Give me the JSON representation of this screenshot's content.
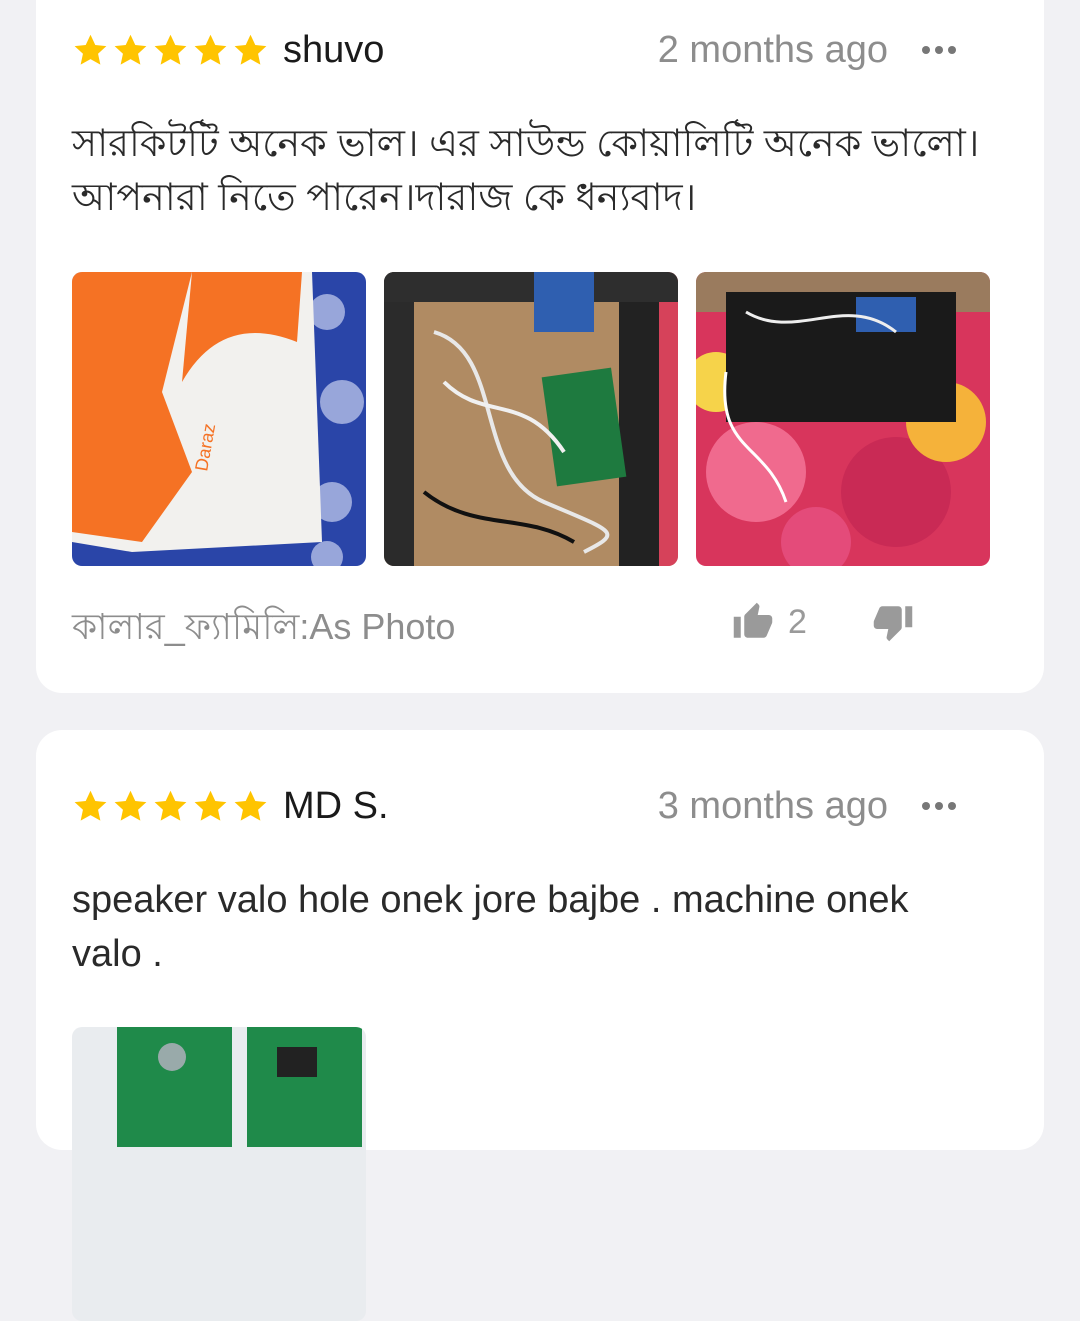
{
  "reviews": [
    {
      "rating": 5,
      "author": "shuvo",
      "time": "2 months ago",
      "text": "সারকিটটি অনেক ভাল। এর সাউন্ড কোয়ালিটি অনেক ভালো। আপনারা নিতে পারেন।দারাজ কে ধন্যবাদ।",
      "photos": [
        "daraz-package-photo",
        "circuit-board-box-photo",
        "assembled-speaker-photo"
      ],
      "variant": "কালার_ফ্যামিলি:As Photo",
      "likes": "2"
    },
    {
      "rating": 5,
      "author": "MD S.",
      "time": "3 months ago",
      "text": "speaker valo hole onek jore bajbe . machine onek valo .",
      "photos": [
        "amplifier-board-photo"
      ]
    }
  ],
  "colors": {
    "star": "#ffc400",
    "background": "#f1f1f4",
    "card": "#ffffff",
    "muted_text": "#8d8d8d",
    "brand_orange": "#f57224"
  },
  "icons": [
    "star-icon",
    "more-options-icon",
    "thumbs-up-icon",
    "thumbs-down-icon"
  ]
}
